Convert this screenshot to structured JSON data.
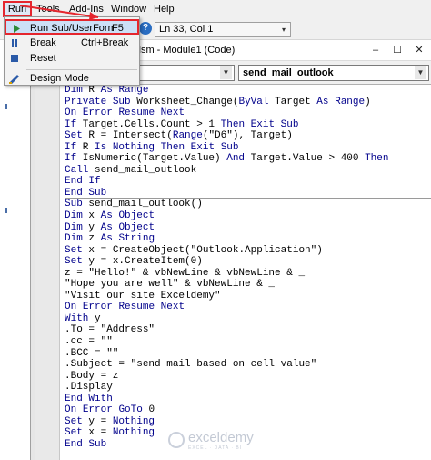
{
  "menubar": {
    "items": [
      "Run",
      "Tools",
      "Add-Ins",
      "Window",
      "Help"
    ]
  },
  "toolbar": {
    "status": "Ln 33, Col 1"
  },
  "run_menu": {
    "items": [
      {
        "label": "Run Sub/UserForm",
        "shortcut": "F5",
        "icon": "play-icon"
      },
      {
        "label": "Break",
        "shortcut": "Ctrl+Break",
        "icon": "pause-icon"
      },
      {
        "label": "Reset",
        "shortcut": "",
        "icon": "stop-icon"
      },
      {
        "label": "Design Mode",
        "shortcut": "",
        "icon": "design-mode-icon"
      }
    ]
  },
  "code_window": {
    "title": "xlsm - Module1 (Code)",
    "object_combo": "",
    "procedure_combo": "send_mail_outlook"
  },
  "code_lines": [
    "Dim R As Range",
    "Private Sub Worksheet_Change(ByVal Target As Range)",
    "On Error Resume Next",
    "If Target.Cells.Count > 1 Then Exit Sub",
    "Set R = Intersect(Range(\"D6\"), Target)",
    "If R Is Nothing Then Exit Sub",
    "If IsNumeric(Target.Value) And Target.Value > 400 Then",
    "Call send_mail_outlook",
    "End If",
    "End Sub",
    "Sub send_mail_outlook()",
    "Dim x As Object",
    "Dim y As Object",
    "Dim z As String",
    "Set x = CreateObject(\"Outlook.Application\")",
    "Set y = x.CreateItem(0)",
    "z = \"Hello!\" & vbNewLine & vbNewLine & _",
    "\"Hope you are well\" & vbNewLine & _",
    "\"Visit our site Exceldemy\"",
    "On Error Resume Next",
    "With y",
    ".To = \"Address\"",
    ".cc = \"\"",
    ".BCC = \"\"",
    ".Subject = \"send mail based on cell value\"",
    ".Body = z",
    ".Display",
    "End With",
    "On Error GoTo 0",
    "Set y = Nothing",
    "Set x = Nothing",
    "End Sub"
  ],
  "watermark": {
    "brand": "exceldemy",
    "tagline": "EXCEL · DATA · BI"
  },
  "colors": {
    "highlight_border": "#e5262e",
    "keyword": "#00008b",
    "menu_highlight": "#cce0f7"
  }
}
